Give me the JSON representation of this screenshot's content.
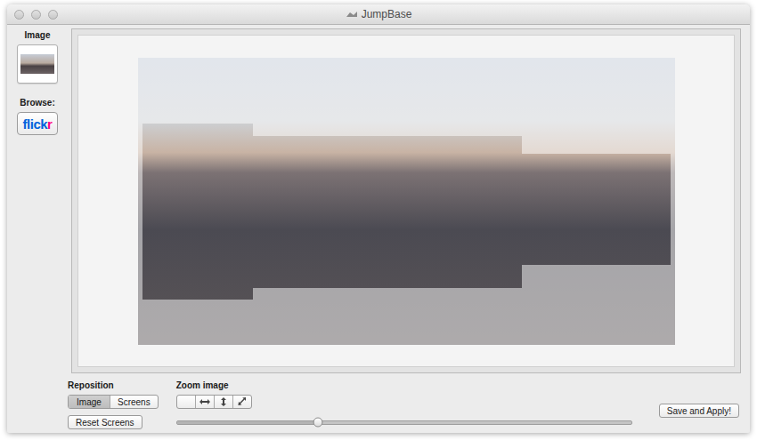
{
  "window": {
    "title": "JumpBase"
  },
  "sidebar": {
    "image_label": "Image",
    "browse_label": "Browse:",
    "flickr": {
      "parts": [
        {
          "text": "flick",
          "color": "#0063dc"
        },
        {
          "text": "r",
          "color": "#ff0084"
        }
      ]
    }
  },
  "reposition": {
    "label": "Reposition",
    "modes": [
      {
        "label": "Image",
        "selected": true
      },
      {
        "label": "Screens",
        "selected": false
      }
    ],
    "reset_button": "Reset Screens"
  },
  "zoom": {
    "label": "Zoom image",
    "modes": [
      {
        "kind": "blank",
        "selected": false
      },
      {
        "kind": "horizontal",
        "selected": false
      },
      {
        "kind": "vertical",
        "selected": false
      },
      {
        "kind": "diagonal",
        "selected": false
      }
    ],
    "slider": {
      "level": 0.31
    }
  },
  "buttons": [
    "Save and Apply!"
  ]
}
